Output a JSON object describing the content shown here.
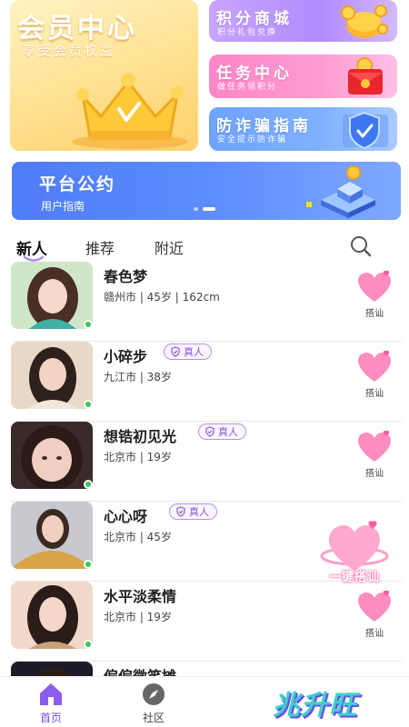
{
  "vip": {
    "title": "会员中心",
    "subtitle": "享受会员权益"
  },
  "feature_cards": [
    {
      "title": "积分商城",
      "subtitle": "积分礼包兑换"
    },
    {
      "title": "任务中心",
      "subtitle": "做任务领积分"
    },
    {
      "title": "防诈骗指南",
      "subtitle": "安全提示防诈骗"
    }
  ],
  "banner": {
    "title": "平台公约",
    "subtitle": "用户指南",
    "page": 2,
    "pages": 2
  },
  "tabs": [
    {
      "label": "新人",
      "active": true
    },
    {
      "label": "推荐",
      "active": false
    },
    {
      "label": "附近",
      "active": false
    }
  ],
  "verified_label": "真人",
  "greet_label": "搭讪",
  "one_key_label": "一键搭讪",
  "users": [
    {
      "name": "春色梦",
      "meta": "赣州市 | 45岁 | 162cm",
      "verified": false,
      "online": true
    },
    {
      "name": "小碎步",
      "meta": "九江市 | 38岁",
      "verified": true,
      "online": true
    },
    {
      "name": "想锆初见光",
      "meta": "北京市 | 19岁",
      "verified": true,
      "online": true
    },
    {
      "name": "心心呀",
      "meta": "北京市 | 45岁",
      "verified": true,
      "online": true
    },
    {
      "name": "水平淡柔情",
      "meta": "北京市 | 19岁",
      "verified": false,
      "online": true
    },
    {
      "name": "偏偏微笑摊",
      "meta": "",
      "verified": false,
      "online": false
    }
  ],
  "bottom_nav": [
    {
      "label": "首页",
      "active": true
    },
    {
      "label": "社区",
      "active": false
    }
  ],
  "brand": "兆升旺",
  "colors": {
    "accent": "#7b4fe6",
    "online": "#35c759",
    "heart": "#ff6fae",
    "banner": "#5c8cff"
  }
}
